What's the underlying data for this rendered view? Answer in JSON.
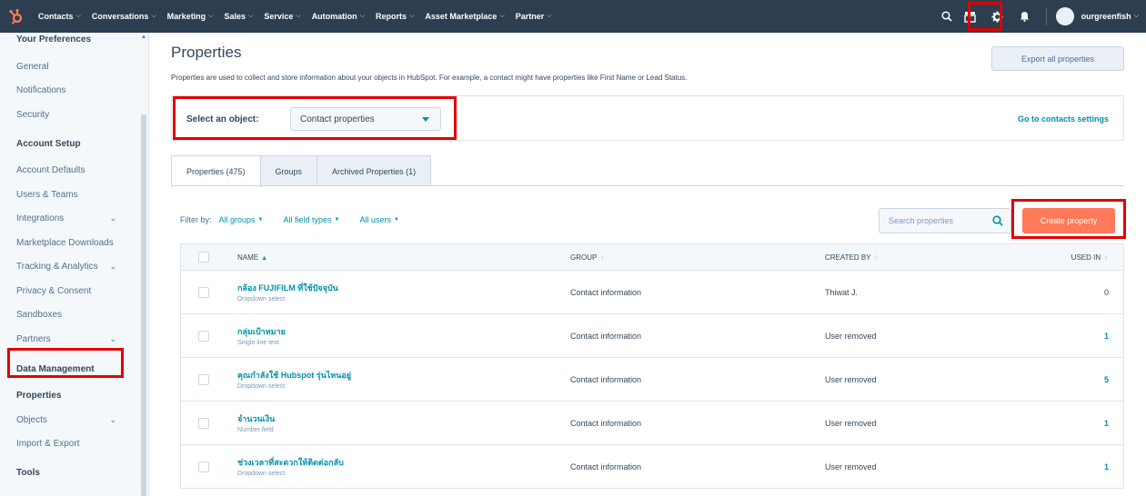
{
  "nav": {
    "items": [
      {
        "label": "Contacts"
      },
      {
        "label": "Conversations"
      },
      {
        "label": "Marketing"
      },
      {
        "label": "Sales"
      },
      {
        "label": "Service"
      },
      {
        "label": "Automation"
      },
      {
        "label": "Reports"
      },
      {
        "label": "Asset Marketplace"
      },
      {
        "label": "Partner"
      }
    ],
    "account": "ourgreenfish"
  },
  "sidebar": {
    "sections": [
      {
        "heading": "Your Preferences"
      },
      {
        "heading": "Account Setup"
      },
      {
        "heading": "Data Management"
      },
      {
        "heading": "Tools"
      }
    ],
    "items": [
      {
        "label": "General"
      },
      {
        "label": "Notifications"
      },
      {
        "label": "Security"
      },
      {
        "label": "Account Defaults"
      },
      {
        "label": "Users & Teams"
      },
      {
        "label": "Integrations"
      },
      {
        "label": "Marketplace Downloads"
      },
      {
        "label": "Tracking & Analytics"
      },
      {
        "label": "Privacy & Consent"
      },
      {
        "label": "Sandboxes"
      },
      {
        "label": "Partners"
      },
      {
        "label": "Properties"
      },
      {
        "label": "Objects"
      },
      {
        "label": "Import & Export"
      }
    ]
  },
  "main": {
    "title": "Properties",
    "description": "Properties are used to collect and store information about your objects in HubSpot. For example, a contact might have properties like First Name or Lead Status.",
    "export_label": "Export all properties",
    "object_label": "Select an object:",
    "object_value": "Contact properties",
    "go_settings": "Go to contacts settings",
    "tabs": [
      {
        "label": "Properties (475)"
      },
      {
        "label": "Groups"
      },
      {
        "label": "Archived Properties (1)"
      }
    ],
    "filter_prefix": "Filter by:",
    "filters": [
      {
        "label": "All groups"
      },
      {
        "label": "All field types"
      },
      {
        "label": "All users"
      }
    ],
    "search_placeholder": "Search properties",
    "create_label": "Create property"
  },
  "table": {
    "headers": {
      "name": "NAME",
      "group": "GROUP",
      "created_by": "CREATED BY",
      "used_in": "USED IN"
    },
    "rows": [
      {
        "name": "กล้อง FUJIFILM ที่ใช้ปัจจุบัน",
        "type": "Dropdown select",
        "group": "Contact information",
        "created_by": "Thiwat J.",
        "used_in": "0"
      },
      {
        "name": "กลุ่มเป้าหมาย",
        "type": "Single line text",
        "group": "Contact information",
        "created_by": "User removed",
        "used_in": "1"
      },
      {
        "name": "คุณกำลังใช้ Hubspot รุ่นไหนอยู่",
        "type": "Dropdown select",
        "group": "Contact information",
        "created_by": "User removed",
        "used_in": "5"
      },
      {
        "name": "จำนวนเงิน",
        "type": "Number field",
        "group": "Contact information",
        "created_by": "User removed",
        "used_in": "1"
      },
      {
        "name": "ช่วงเวลาที่สะดวกให้ติดต่อกลับ",
        "type": "Dropdown select",
        "group": "Contact information",
        "created_by": "User removed",
        "used_in": "1"
      }
    ]
  },
  "colors": {
    "nav_bg": "#2d3e50",
    "accent": "#0091ae",
    "create": "#ff7a59",
    "highlight": "#e00000"
  }
}
